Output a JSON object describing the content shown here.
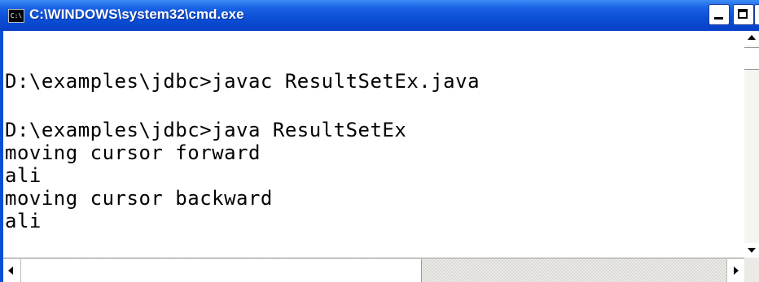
{
  "window": {
    "title": "C:\\WINDOWS\\system32\\cmd.exe",
    "icon_text": "C:\\",
    "icon": "console-icon",
    "close_glyph": "×"
  },
  "console": {
    "lines": [
      "D:\\examples\\jdbc>javac ResultSetEx.java",
      "D:\\examples\\jdbc>java ResultSetEx",
      "moving cursor forward",
      "ali",
      "moving cursor backward",
      "ali"
    ]
  },
  "colors": {
    "titlebar": "#0a4fd6",
    "console_background": "#ffffff",
    "console_text": "#000000"
  }
}
